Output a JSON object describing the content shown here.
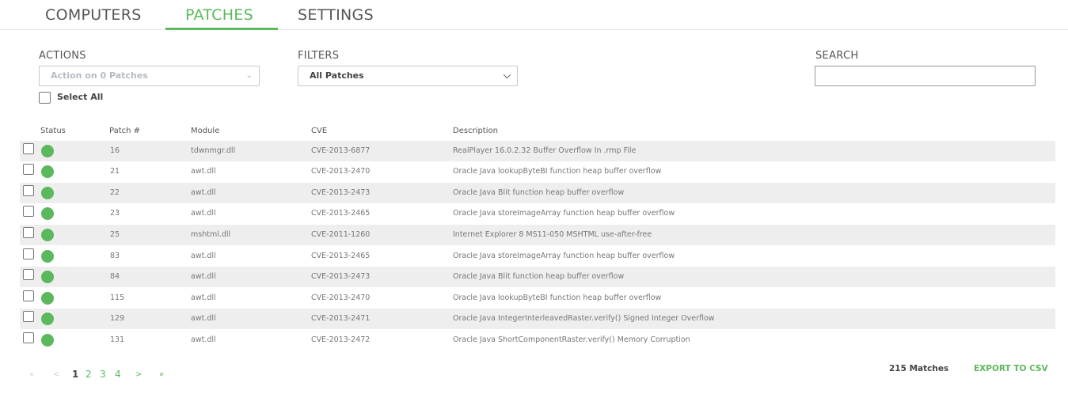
{
  "tabs": [
    {
      "label": "COMPUTERS",
      "active": false
    },
    {
      "label": "PATCHES",
      "active": true
    },
    {
      "label": "SETTINGS",
      "active": false
    }
  ],
  "accent_color": "#5cb85c",
  "actions": {
    "label": "ACTIONS",
    "select_value": "Action on 0 Patches",
    "disabled": true
  },
  "filters": {
    "label": "FILTERS",
    "select_value": "All Patches"
  },
  "search": {
    "label": "SEARCH",
    "value": ""
  },
  "select_all": {
    "label": "Select All",
    "checked": false
  },
  "table": {
    "headers": [
      "Status",
      "Patch #",
      "Module",
      "CVE",
      "Description"
    ],
    "rows": [
      {
        "status": "green",
        "patch": "16",
        "module": "tdwnmgr.dll",
        "cve": "CVE-2013-6877",
        "description": "RealPlayer 16.0.2.32 Buffer Overflow In .rmp File"
      },
      {
        "status": "green",
        "patch": "21",
        "module": "awt.dll",
        "cve": "CVE-2013-2470",
        "description": "Oracle Java lookupByteBI function heap buffer overflow"
      },
      {
        "status": "green",
        "patch": "22",
        "module": "awt.dll",
        "cve": "CVE-2013-2473",
        "description": "Oracle Java Blit function heap buffer overflow"
      },
      {
        "status": "green",
        "patch": "23",
        "module": "awt.dll",
        "cve": "CVE-2013-2465",
        "description": "Oracle Java storeImageArray function heap buffer overflow"
      },
      {
        "status": "green",
        "patch": "25",
        "module": "mshtml.dll",
        "cve": "CVE-2011-1260",
        "description": "Internet Explorer 8 MS11-050 MSHTML use-after-free"
      },
      {
        "status": "green",
        "patch": "83",
        "module": "awt.dll",
        "cve": "CVE-2013-2465",
        "description": "Oracle Java storeImageArray function heap buffer overflow"
      },
      {
        "status": "green",
        "patch": "84",
        "module": "awt.dll",
        "cve": "CVE-2013-2473",
        "description": "Oracle Java Blit function heap buffer overflow"
      },
      {
        "status": "green",
        "patch": "115",
        "module": "awt.dll",
        "cve": "CVE-2013-2470",
        "description": "Oracle Java lookupByteBI function heap buffer overflow"
      },
      {
        "status": "green",
        "patch": "129",
        "module": "awt.dll",
        "cve": "CVE-2013-2471",
        "description": "Oracle Java IntegerInterleavedRaster.verify() Signed Integer Overflow"
      },
      {
        "status": "green",
        "patch": "131",
        "module": "awt.dll",
        "cve": "CVE-2013-2472",
        "description": "Oracle Java ShortComponentRaster.verify() Memory Corruption"
      }
    ]
  },
  "pagination": {
    "first": "«",
    "prev": "<",
    "pages": [
      "1",
      "2",
      "3",
      "4"
    ],
    "current": "1",
    "next": ">",
    "last": "»"
  },
  "footer": {
    "matches": "215 Matches",
    "export_label": "EXPORT TO CSV"
  }
}
